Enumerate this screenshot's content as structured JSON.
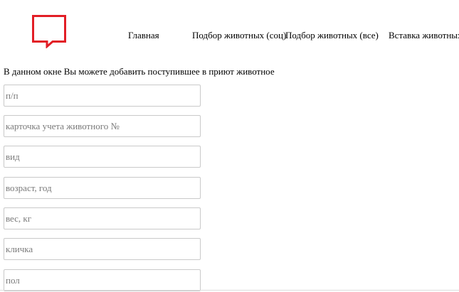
{
  "logo": {
    "icon": "speech-bubble-logo-icon",
    "color": "#e21e26"
  },
  "nav": {
    "items": [
      {
        "label": "Главная"
      },
      {
        "label": "Подбор животных (соц)"
      },
      {
        "label": "Подбор животных (все)"
      },
      {
        "label": "Вставка животных"
      }
    ]
  },
  "intro_text": "В данном окне Вы можете добавить поступившее в приют животное",
  "form": {
    "fields": [
      {
        "placeholder": "п/п",
        "value": ""
      },
      {
        "placeholder": "карточка учета животного №",
        "value": ""
      },
      {
        "placeholder": "вид",
        "value": ""
      },
      {
        "placeholder": "возраст, год",
        "value": ""
      },
      {
        "placeholder": "вес, кг",
        "value": ""
      },
      {
        "placeholder": "кличка",
        "value": ""
      },
      {
        "placeholder": "пол",
        "value": ""
      }
    ]
  }
}
